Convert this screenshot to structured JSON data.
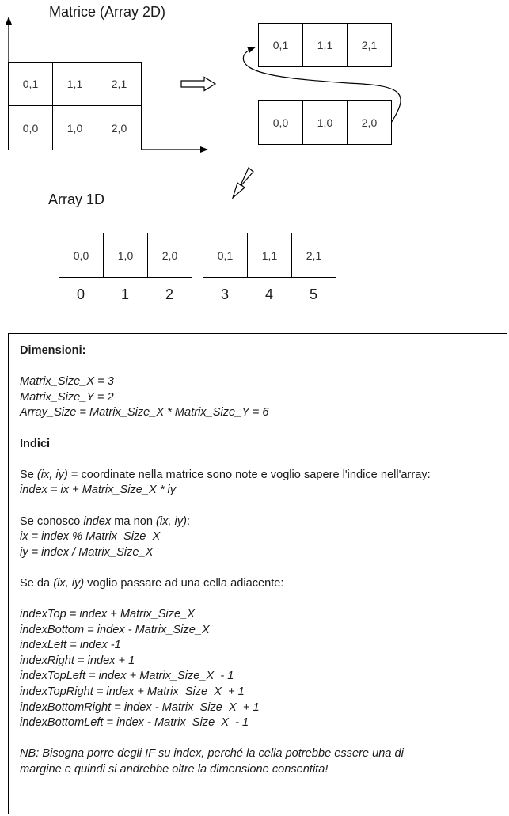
{
  "matrix": {
    "title": "Matrice (Array 2D)",
    "rows": [
      [
        "0,1",
        "1,1",
        "2,1"
      ],
      [
        "0,0",
        "1,0",
        "2,0"
      ]
    ]
  },
  "split": {
    "top_row": [
      "0,1",
      "1,1",
      "2,1"
    ],
    "bottom_row": [
      "0,0",
      "1,0",
      "2,0"
    ]
  },
  "array1d": {
    "title": "Array 1D",
    "cells": [
      "0,0",
      "1,0",
      "2,0",
      "0,1",
      "1,1",
      "2,1"
    ],
    "indices": [
      "0",
      "1",
      "2",
      "3",
      "4",
      "5"
    ]
  },
  "notes": {
    "dimensioni_heading": "Dimensioni:",
    "size_x": "Matrix_Size_X = 3",
    "size_y": "Matrix_Size_Y = 2",
    "array_size": "Array_Size = Matrix_Size_X * Matrix_Size_Y = 6",
    "indici_heading": "Indici",
    "se1_pre": "Se ",
    "se1_coords": "(ix, iy)",
    "se1_post": " = coordinate nella matrice sono note e voglio sapere l'indice nell'array:",
    "index_formula": "index = ix + Matrix_Size_X * iy",
    "se2_pre": "Se conosco ",
    "se2_index": "index",
    "se2_mid": " ma non ",
    "se2_coords": "(ix, iy)",
    "se2_post": ":",
    "ix_formula": "ix = index % Matrix_Size_X",
    "iy_formula": "iy = index / Matrix_Size_X",
    "se3_pre": "Se da ",
    "se3_coords": "(ix, iy)",
    "se3_post": " voglio passare ad una cella adiacente:",
    "adjacent": [
      "indexTop = index + Matrix_Size_X",
      "indexBottom = index - Matrix_Size_X",
      "indexLeft = index -1",
      "indexRight = index + 1",
      "indexTopLeft = index + Matrix_Size_X  - 1",
      "indexTopRight = index + Matrix_Size_X  + 1",
      "indexBottomRight = index - Matrix_Size_X  + 1",
      "indexBottomLeft = index - Matrix_Size_X  - 1"
    ],
    "nb_line1": "NB: Bisogna porre degli IF su index, perché la cella potrebbe essere una di",
    "nb_line2": "margine e quindi si andrebbe oltre la dimensione consentita!"
  }
}
